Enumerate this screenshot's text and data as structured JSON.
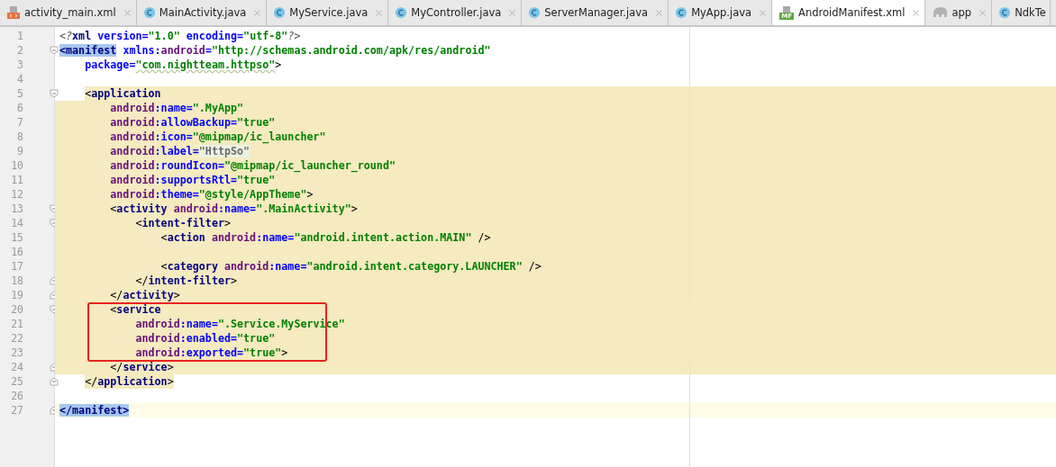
{
  "tabs": [
    {
      "label": "activity_main.xml",
      "kind": "xml",
      "selected": false
    },
    {
      "label": "MainActivity.java",
      "kind": "class",
      "selected": false
    },
    {
      "label": "MyService.java",
      "kind": "class",
      "selected": false
    },
    {
      "label": "MyController.java",
      "kind": "class",
      "selected": false
    },
    {
      "label": "ServerManager.java",
      "kind": "class",
      "selected": false
    },
    {
      "label": "MyApp.java",
      "kind": "class",
      "selected": false
    },
    {
      "label": "AndroidManifest.xml",
      "kind": "manifest",
      "badge": "MF",
      "selected": true
    },
    {
      "label": "app",
      "kind": "gradle",
      "selected": false
    },
    {
      "label": "NdkTe",
      "kind": "class",
      "selected": false
    }
  ],
  "lines": [
    {
      "number": "1",
      "fold_start": false,
      "fold_end": false,
      "boxed": false,
      "tokens": [
        {
          "text": "<?",
          "kind": "pi"
        },
        {
          "text": "xml",
          "kind": "tag"
        },
        {
          "text": " version=",
          "kind": "attr"
        },
        {
          "text": "\"1.0\"",
          "kind": "value"
        },
        {
          "text": " encoding=",
          "kind": "attr"
        },
        {
          "text": "\"utf-8\"",
          "kind": "value"
        },
        {
          "text": "?>",
          "kind": "pi"
        }
      ]
    },
    {
      "number": "2",
      "fold_start": true,
      "fold_end": false,
      "boxed": false,
      "tokens": [
        {
          "text": "<manifest",
          "kind": "selected_tag"
        },
        {
          "text": " xmlns:",
          "kind": "attr"
        },
        {
          "text": "android",
          "kind": "ns"
        },
        {
          "text": "=",
          "kind": "attr"
        },
        {
          "text": "\"http://schemas.android.com/apk/res/android\"",
          "kind": "value"
        }
      ]
    },
    {
      "number": "3",
      "fold_start": false,
      "fold_end": false,
      "boxed": false,
      "tokens": [
        {
          "text": "    package=",
          "kind": "attr"
        },
        {
          "text": "\"com.nightteam.httpso\"",
          "kind": "typo_value"
        },
        {
          "text": ">",
          "kind": "punct"
        }
      ]
    },
    {
      "number": "4",
      "fold_start": false,
      "fold_end": false,
      "boxed": false
    },
    {
      "number": "5",
      "kind": "scope_start",
      "fold_start": true,
      "fold_end": false,
      "boxed": false,
      "tokens": [
        {
          "text": "    <",
          "kind": "punct"
        },
        {
          "text": "application",
          "kind": "tag"
        }
      ]
    },
    {
      "number": "6",
      "kind": "scope",
      "fold_start": false,
      "fold_end": false,
      "boxed": false,
      "tokens": [
        {
          "text": "        android",
          "kind": "ns"
        },
        {
          "text": ":name=",
          "kind": "attr"
        },
        {
          "text": "\".MyApp\"",
          "kind": "value"
        }
      ]
    },
    {
      "number": "7",
      "kind": "scope",
      "fold_start": false,
      "fold_end": false,
      "boxed": false,
      "tokens": [
        {
          "text": "        android",
          "kind": "ns"
        },
        {
          "text": ":allowBackup=",
          "kind": "attr"
        },
        {
          "text": "\"true\"",
          "kind": "value"
        }
      ]
    },
    {
      "number": "8",
      "kind": "scope",
      "fold_start": false,
      "fold_end": false,
      "boxed": false,
      "tokens": [
        {
          "text": "        android",
          "kind": "ns"
        },
        {
          "text": ":icon=",
          "kind": "attr"
        },
        {
          "text": "\"@mipmap/ic_launcher\"",
          "kind": "value"
        }
      ]
    },
    {
      "number": "9",
      "kind": "scope",
      "fold_start": false,
      "fold_end": false,
      "boxed": false,
      "tokens": [
        {
          "text": "        android",
          "kind": "ns"
        },
        {
          "text": ":label=",
          "kind": "attr"
        },
        {
          "text": "\"HttpSo\"",
          "kind": "muted_value"
        }
      ]
    },
    {
      "number": "10",
      "kind": "scope",
      "fold_start": false,
      "fold_end": false,
      "boxed": false,
      "tokens": [
        {
          "text": "        android",
          "kind": "ns"
        },
        {
          "text": ":roundIcon=",
          "kind": "attr"
        },
        {
          "text": "\"@mipmap/ic_launcher_round\"",
          "kind": "value"
        }
      ]
    },
    {
      "number": "11",
      "kind": "scope",
      "fold_start": false,
      "fold_end": false,
      "boxed": false,
      "tokens": [
        {
          "text": "        android",
          "kind": "ns"
        },
        {
          "text": ":supportsRtl=",
          "kind": "attr"
        },
        {
          "text": "\"true\"",
          "kind": "value"
        }
      ]
    },
    {
      "number": "12",
      "kind": "scope",
      "fold_start": false,
      "fold_end": false,
      "boxed": false,
      "tokens": [
        {
          "text": "        android",
          "kind": "ns"
        },
        {
          "text": ":theme=",
          "kind": "attr"
        },
        {
          "text": "\"@style/AppTheme\"",
          "kind": "value"
        },
        {
          "text": ">",
          "kind": "punct"
        }
      ]
    },
    {
      "number": "13",
      "kind": "scope",
      "fold_start": true,
      "fold_end": false,
      "boxed": false,
      "tokens": [
        {
          "text": "        <",
          "kind": "punct"
        },
        {
          "text": "activity",
          "kind": "tag"
        },
        {
          "text": " android",
          "kind": "ns"
        },
        {
          "text": ":name=",
          "kind": "attr"
        },
        {
          "text": "\".MainActivity\"",
          "kind": "value"
        },
        {
          "text": ">",
          "kind": "punct"
        }
      ]
    },
    {
      "number": "14",
      "kind": "scope",
      "fold_start": true,
      "fold_end": false,
      "boxed": false,
      "tokens": [
        {
          "text": "            <",
          "kind": "punct"
        },
        {
          "text": "intent-filter",
          "kind": "tag"
        },
        {
          "text": ">",
          "kind": "punct"
        }
      ]
    },
    {
      "number": "15",
      "kind": "scope",
      "fold_start": false,
      "fold_end": false,
      "boxed": false,
      "tokens": [
        {
          "text": "                <",
          "kind": "punct"
        },
        {
          "text": "action",
          "kind": "tag"
        },
        {
          "text": " android",
          "kind": "ns"
        },
        {
          "text": ":name=",
          "kind": "attr"
        },
        {
          "text": "\"android.intent.action.MAIN\"",
          "kind": "value"
        },
        {
          "text": " />",
          "kind": "punct"
        }
      ]
    },
    {
      "number": "16",
      "kind": "scope",
      "fold_start": false,
      "fold_end": false,
      "boxed": false
    },
    {
      "number": "17",
      "kind": "scope",
      "fold_start": false,
      "fold_end": false,
      "boxed": false,
      "tokens": [
        {
          "text": "                <",
          "kind": "punct"
        },
        {
          "text": "category",
          "kind": "tag"
        },
        {
          "text": " android",
          "kind": "ns"
        },
        {
          "text": ":name=",
          "kind": "attr"
        },
        {
          "text": "\"android.intent.category.LAUNCHER\"",
          "kind": "value"
        },
        {
          "text": " />",
          "kind": "punct"
        }
      ]
    },
    {
      "number": "18",
      "kind": "scope",
      "fold_start": false,
      "fold_end": true,
      "boxed": false,
      "tokens": [
        {
          "text": "            </",
          "kind": "punct"
        },
        {
          "text": "intent-filter",
          "kind": "tag"
        },
        {
          "text": ">",
          "kind": "punct"
        }
      ]
    },
    {
      "number": "19",
      "kind": "scope",
      "fold_start": false,
      "fold_end": true,
      "boxed": false,
      "tokens": [
        {
          "text": "        </",
          "kind": "punct"
        },
        {
          "text": "activity",
          "kind": "tag"
        },
        {
          "text": ">",
          "kind": "punct"
        }
      ]
    },
    {
      "number": "20",
      "kind": "scope",
      "fold_start": true,
      "fold_end": false,
      "boxed": true,
      "tokens": [
        {
          "text": "        <",
          "kind": "punct"
        },
        {
          "text": "service",
          "kind": "tag"
        }
      ]
    },
    {
      "number": "21",
      "kind": "scope",
      "fold_start": false,
      "fold_end": false,
      "boxed": true,
      "tokens": [
        {
          "text": "            android",
          "kind": "ns"
        },
        {
          "text": ":name=",
          "kind": "attr"
        },
        {
          "text": "\".Service.MyService\"",
          "kind": "value"
        }
      ]
    },
    {
      "number": "22",
      "kind": "scope",
      "fold_start": false,
      "fold_end": false,
      "boxed": true,
      "tokens": [
        {
          "text": "            android",
          "kind": "ns"
        },
        {
          "text": ":enabled=",
          "kind": "attr"
        },
        {
          "text": "\"true\"",
          "kind": "value"
        }
      ]
    },
    {
      "number": "23",
      "kind": "scope",
      "fold_start": false,
      "fold_end": false,
      "boxed": true,
      "tokens": [
        {
          "text": "            android",
          "kind": "ns"
        },
        {
          "text": ":exported=",
          "kind": "attr"
        },
        {
          "text": "\"true\"",
          "kind": "value"
        },
        {
          "text": ">",
          "kind": "punct"
        }
      ]
    },
    {
      "number": "24",
      "kind": "scope",
      "fold_start": false,
      "fold_end": true,
      "boxed": false,
      "tokens": [
        {
          "text": "        </",
          "kind": "punct"
        },
        {
          "text": "service",
          "kind": "tag"
        },
        {
          "text": ">",
          "kind": "punct"
        }
      ]
    },
    {
      "number": "25",
      "kind": "scope_end",
      "fold_start": false,
      "fold_end": true,
      "boxed": false,
      "tokens": [
        {
          "text": "    </",
          "kind": "punct"
        },
        {
          "text": "application",
          "kind": "tag"
        },
        {
          "text": ">",
          "kind": "punct"
        }
      ]
    },
    {
      "number": "26",
      "fold_start": false,
      "fold_end": false,
      "boxed": false
    },
    {
      "number": "27",
      "kind": "current",
      "fold_start": false,
      "fold_end": true,
      "boxed": false,
      "tokens": [
        {
          "text": "</manifest>",
          "kind": "selected_tag"
        }
      ]
    }
  ]
}
